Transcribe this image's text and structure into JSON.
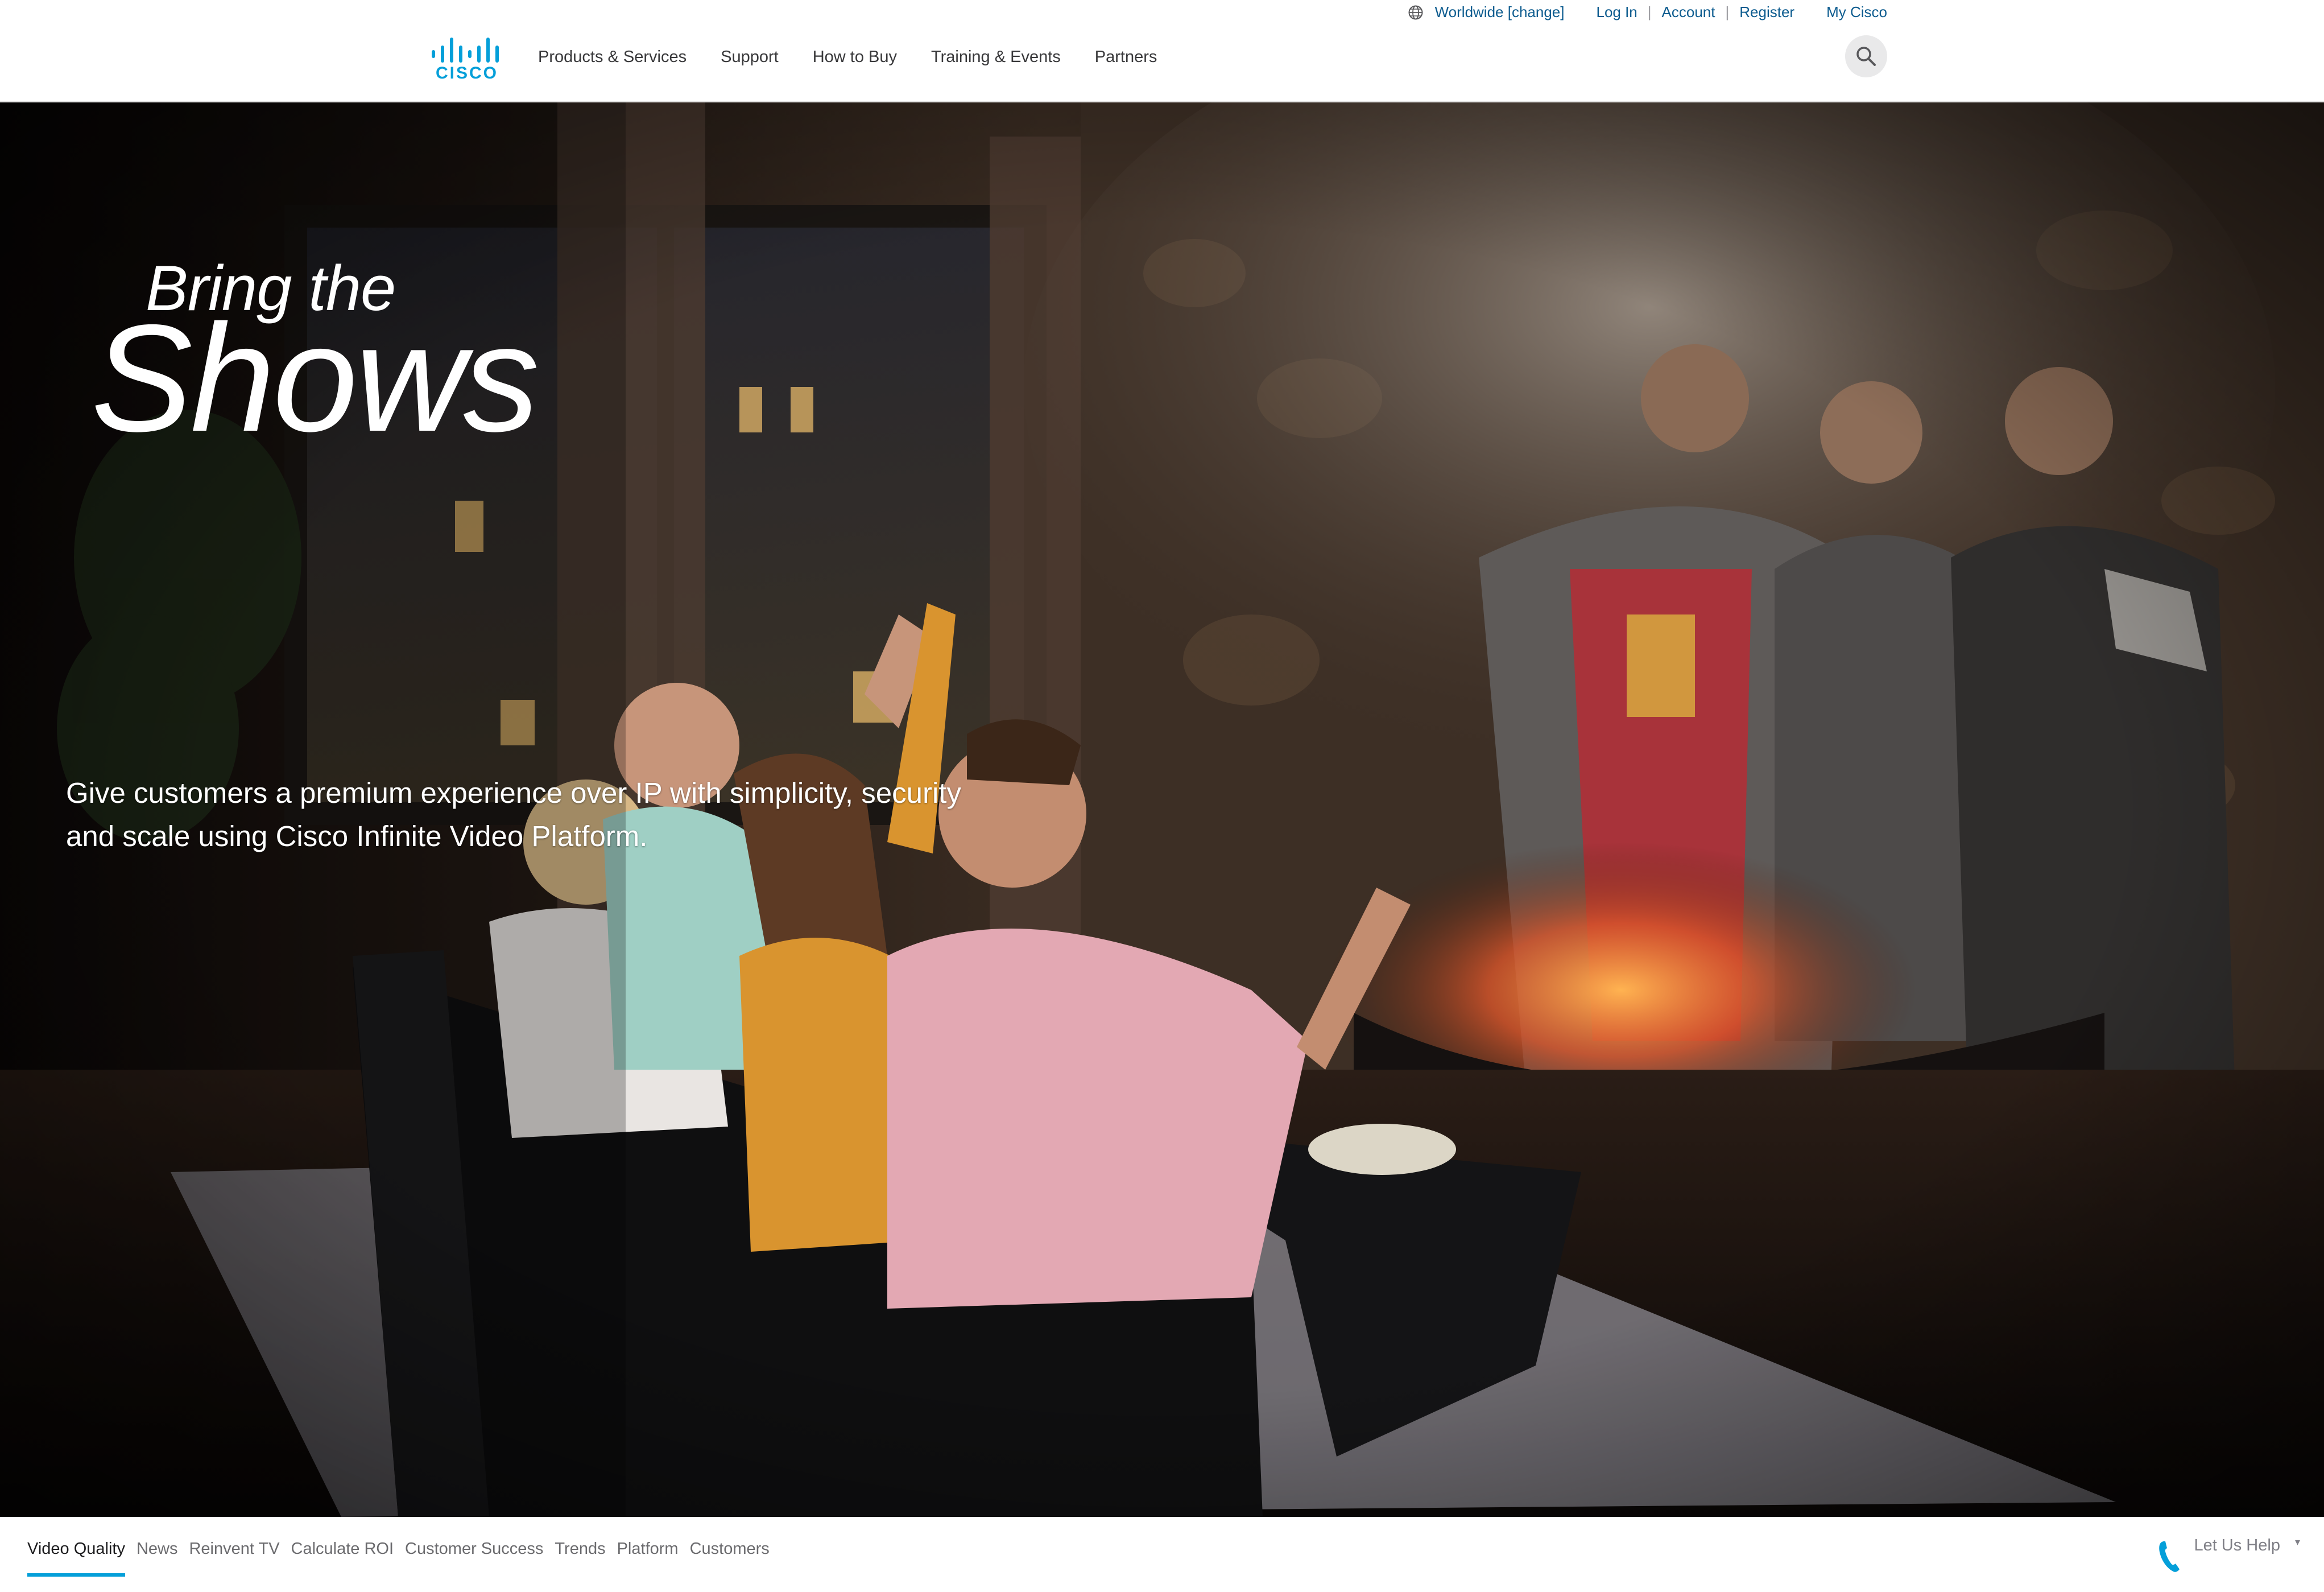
{
  "utility": {
    "region": "Worldwide [change]",
    "login": "Log In",
    "account": "Account",
    "register": "Register",
    "my_cisco": "My Cisco",
    "separator": "|"
  },
  "brand": {
    "logo_text": "CISCO",
    "logo_color": "#049fd9",
    "icon": "cisco-bridge-logo"
  },
  "nav": {
    "items": [
      {
        "label": "Products & Services"
      },
      {
        "label": "Support"
      },
      {
        "label": "How to Buy"
      },
      {
        "label": "Training & Events"
      },
      {
        "label": "Partners"
      }
    ],
    "search_icon": "search-icon"
  },
  "hero": {
    "kicker": "Bring the",
    "title": "Shows",
    "description": "Give customers a premium experience over IP with simplicity, security and scale using Cisco Infinite Video Platform."
  },
  "tabs": {
    "items": [
      {
        "label": "Video Quality",
        "active": true
      },
      {
        "label": "News"
      },
      {
        "label": "Reinvent TV"
      },
      {
        "label": "Calculate ROI"
      },
      {
        "label": "Customer Success"
      },
      {
        "label": "Trends"
      },
      {
        "label": "Platform"
      },
      {
        "label": "Customers"
      }
    ],
    "active_color": "#049fd9"
  },
  "help": {
    "label": "Let Us Help",
    "caret": "▾",
    "icon": "phone-icon",
    "icon_color": "#049fd9"
  }
}
